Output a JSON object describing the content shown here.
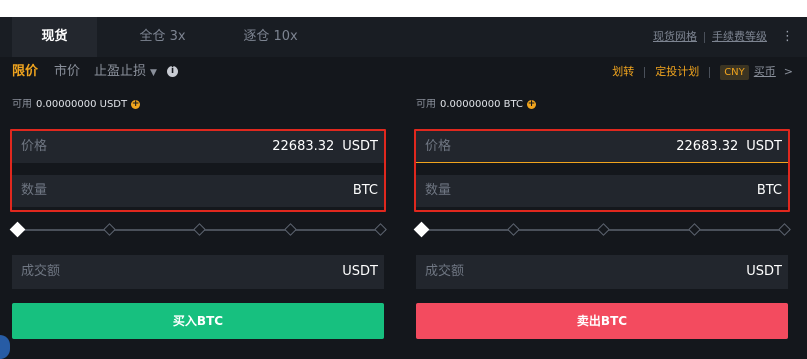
{
  "tabs": [
    {
      "label": "现货"
    },
    {
      "label": "全仓 3x"
    },
    {
      "label": "逐仓 10x"
    }
  ],
  "top_links": {
    "grid": "现货网格",
    "fee": "手续费等级",
    "more_icon": "more-vertical-icon"
  },
  "order_types": {
    "limit": "限价",
    "market": "市价",
    "stop": "止盈止损"
  },
  "right_actions": {
    "transfer": "划转",
    "plan": "定投计划",
    "currency": "CNY",
    "buy_coin": "买币"
  },
  "buy": {
    "avail_label": "可用",
    "avail_amount": "0.00000000 USDT",
    "price_label": "价格",
    "price_value": "22683.32",
    "price_unit": "USDT",
    "qty_label": "数量",
    "qty_unit": "BTC",
    "total_label": "成交额",
    "total_unit": "USDT",
    "button": "买入BTC"
  },
  "sell": {
    "avail_label": "可用",
    "avail_amount": "0.00000000 BTC",
    "price_label": "价格",
    "price_value": "22683.32",
    "price_unit": "USDT",
    "qty_label": "数量",
    "qty_unit": "BTC",
    "total_label": "成交额",
    "total_unit": "USDT",
    "button": "卖出BTC"
  },
  "colors": {
    "accent": "#f0a41e",
    "buy": "#17c07f",
    "sell": "#f34b5f",
    "highlight": "#e0281e"
  }
}
